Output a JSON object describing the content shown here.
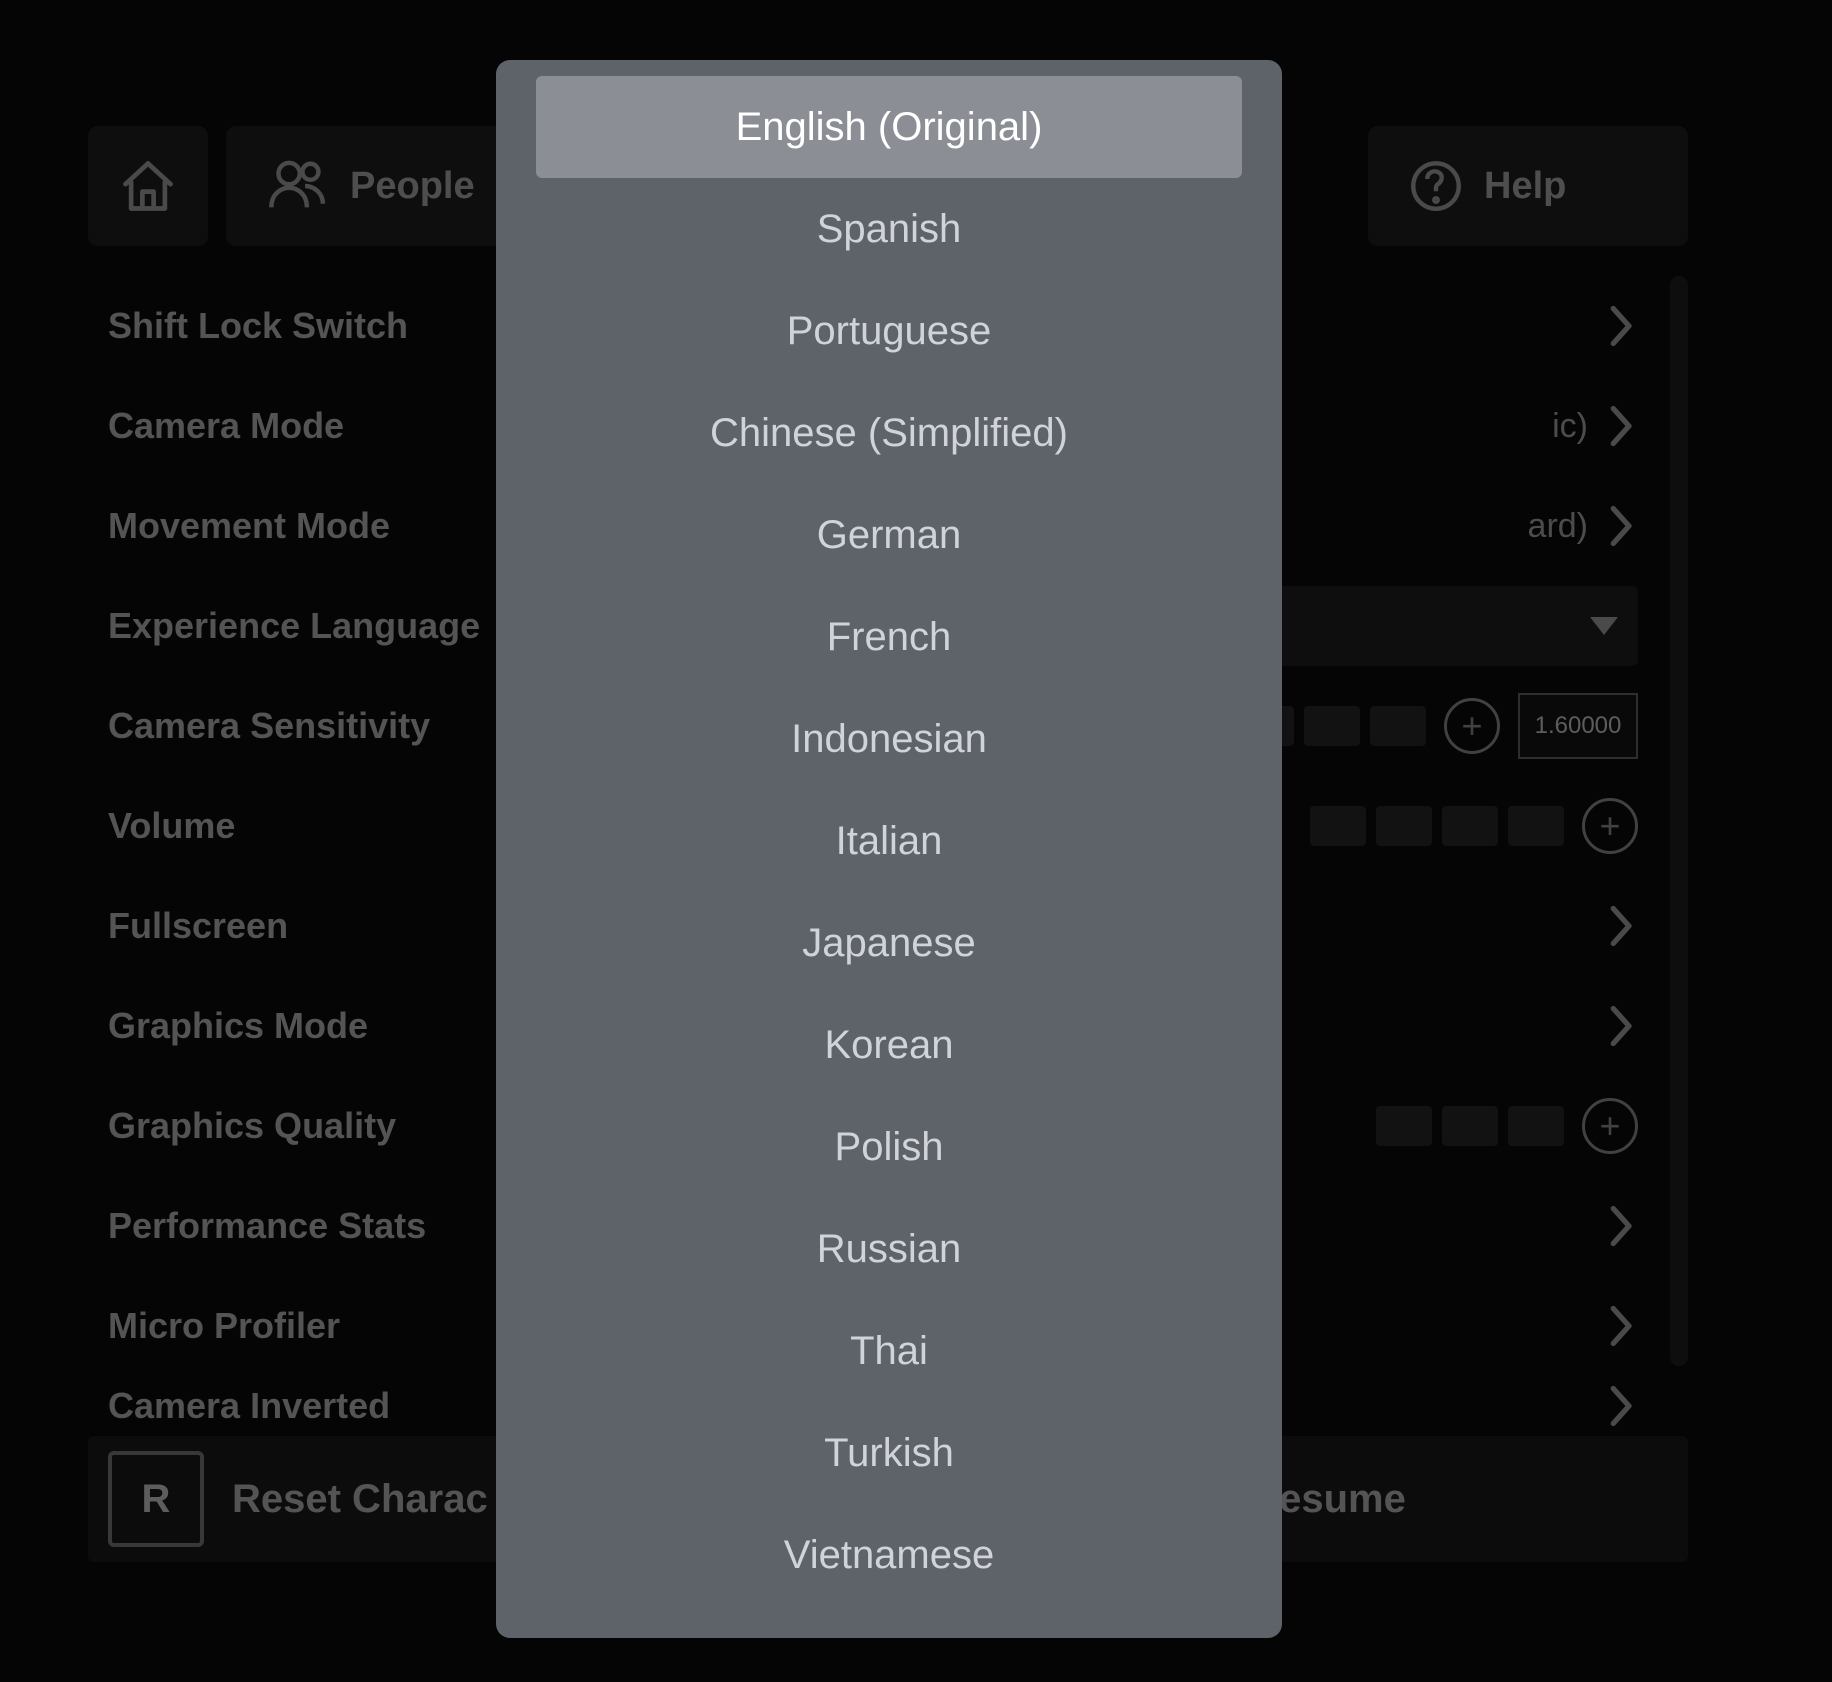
{
  "tabs": {
    "people": "People",
    "help": "Help"
  },
  "settings": {
    "shift_lock": "Shift Lock Switch",
    "camera_mode": "Camera Mode",
    "camera_mode_val_suffix": "ic)",
    "movement_mode": "Movement Mode",
    "movement_mode_val_suffix": "ard)",
    "exp_lang": "Experience Language",
    "cam_sens": "Camera Sensitivity",
    "cam_sens_val": "1.60000",
    "volume": "Volume",
    "fullscreen": "Fullscreen",
    "gfx_mode": "Graphics Mode",
    "gfx_quality": "Graphics Quality",
    "perf_stats": "Performance Stats",
    "micro_profiler": "Micro Profiler",
    "camera_inverted": "Camera Inverted"
  },
  "bottom": {
    "reset_key": "R",
    "reset_label": "Reset Charac",
    "resume": "Resume"
  },
  "languages": [
    "English (Original)",
    "Spanish",
    "Portuguese",
    "Chinese (Simplified)",
    "German",
    "French",
    "Indonesian",
    "Italian",
    "Japanese",
    "Korean",
    "Polish",
    "Russian",
    "Thai",
    "Turkish",
    "Vietnamese"
  ],
  "selected_language_index": 0
}
